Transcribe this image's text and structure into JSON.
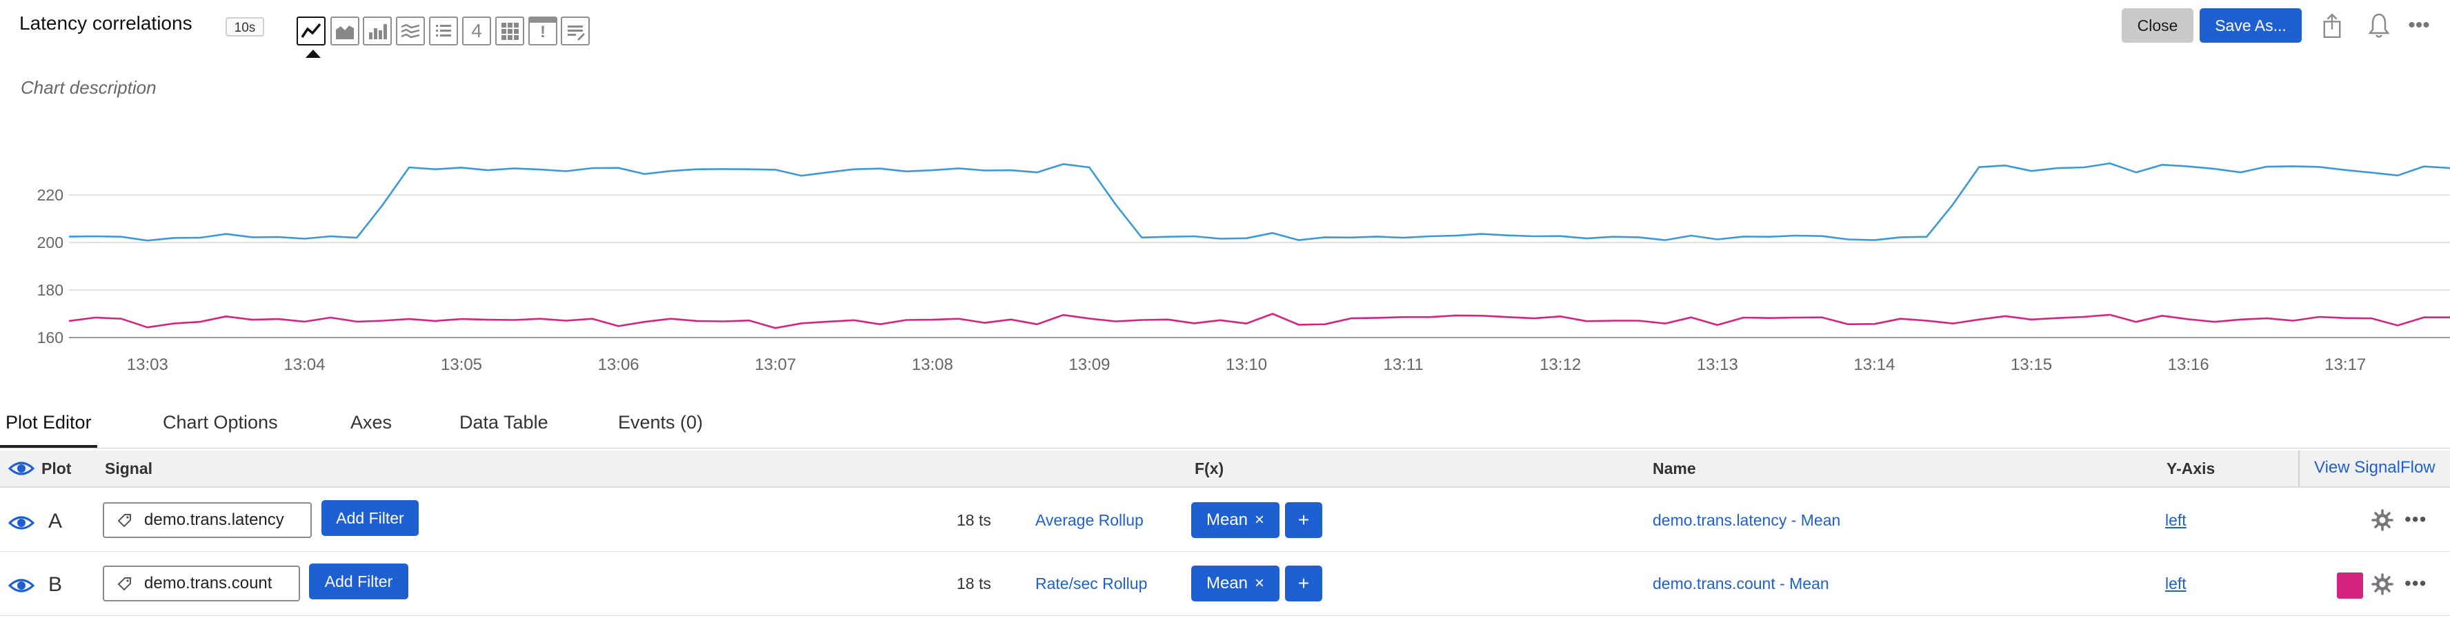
{
  "header": {
    "title": "Latency correlations",
    "resolution_badge": "10s",
    "chart_types": [
      {
        "name": "line-chart-icon",
        "active": true
      },
      {
        "name": "area-chart-icon",
        "active": false
      },
      {
        "name": "column-chart-icon",
        "active": false
      },
      {
        "name": "histogram-chart-icon",
        "active": false
      },
      {
        "name": "list-chart-icon",
        "active": false
      },
      {
        "name": "single-value-icon",
        "label": "4",
        "active": false
      },
      {
        "name": "heatmap-icon",
        "active": false
      },
      {
        "name": "event-feed-icon",
        "label": "!",
        "active": false
      },
      {
        "name": "text-note-icon",
        "active": false
      }
    ],
    "close_label": "Close",
    "save_label": "Save As...",
    "icons": [
      "share-icon",
      "bell-icon",
      "more-icon"
    ]
  },
  "description_placeholder": "Chart description",
  "chart_data": {
    "type": "line",
    "title": "",
    "xlabel": "",
    "ylabel": "",
    "ylim": [
      160,
      230
    ],
    "y_ticks": [
      "160",
      "180",
      "200",
      "220"
    ],
    "x_ticks": [
      "13:03",
      "13:04",
      "13:05",
      "13:06",
      "13:07",
      "13:08",
      "13:09",
      "13:10",
      "13:11",
      "13:12",
      "13:13",
      "13:14",
      "13:15",
      "13:16",
      "13:17"
    ],
    "x_start": "13:02:30",
    "x_end": "13:17:40",
    "grid": true,
    "legend": "none",
    "series": [
      {
        "color": "#3a9ad9",
        "values": [
          202.5,
          202.6,
          202.4,
          200.8,
          201.9,
          202.0,
          203.6,
          202.2,
          202.3,
          201.6,
          202.6,
          202.0,
          216,
          231.6,
          230.8,
          231.5,
          230.4,
          231.2,
          230.7,
          230.0,
          231.3,
          231.4,
          228.8,
          230.1,
          230.8,
          230.9,
          230.8,
          230.6,
          228.1,
          229.5,
          230.8,
          231.1,
          229.9,
          230.4,
          231.2,
          230.3,
          230.4,
          229.5,
          233.0,
          231.6,
          216,
          202.1,
          202.4,
          202.6,
          201.6,
          201.8,
          204.0,
          201.0,
          202.2,
          202.1,
          202.5,
          202.0,
          202.6,
          202.9,
          203.6,
          203.0,
          202.6,
          202.7,
          201.7,
          202.4,
          202.2,
          201.0,
          202.9,
          201.3,
          202.5,
          202.4,
          202.9,
          202.7,
          201.3,
          201.0,
          202.2,
          202.4,
          216,
          231.7,
          232.4,
          230.1,
          231.3,
          231.6,
          233.3,
          229.5,
          232.7,
          232.0,
          231.0,
          229.5,
          231.9,
          232.1,
          231.8,
          230.5,
          229.4,
          228.2,
          232.0,
          231.3
        ]
      },
      {
        "color": "#d6237f",
        "values": [
          167.0,
          168.4,
          167.9,
          164.3,
          165.9,
          166.6,
          168.9,
          167.5,
          167.8,
          166.7,
          168.4,
          166.7,
          167.1,
          167.8,
          167.0,
          167.8,
          167.5,
          167.4,
          167.9,
          167.1,
          167.9,
          164.8,
          166.6,
          167.9,
          167.0,
          166.8,
          167.2,
          164.0,
          166.0,
          166.7,
          167.3,
          165.6,
          167.4,
          167.5,
          167.9,
          166.2,
          167.6,
          165.6,
          169.5,
          168.0,
          166.8,
          167.4,
          167.6,
          166.0,
          167.3,
          165.9,
          170.0,
          165.4,
          165.6,
          168.1,
          168.3,
          168.6,
          168.6,
          169.3,
          169.2,
          168.6,
          168.1,
          168.9,
          166.9,
          167.1,
          167.1,
          165.9,
          168.5,
          165.3,
          168.4,
          168.2,
          168.4,
          168.5,
          165.6,
          165.7,
          167.9,
          167.1,
          165.9,
          167.6,
          169.0,
          167.6,
          168.2,
          168.7,
          169.6,
          166.6,
          169.2,
          167.7,
          166.6,
          167.6,
          168.1,
          167.1,
          168.7,
          168.2,
          168.1,
          165.1,
          168.5,
          168.5
        ]
      }
    ]
  },
  "tabs": {
    "plot_editor": "Plot Editor",
    "chart_options": "Chart Options",
    "axes": "Axes",
    "data_table": "Data Table",
    "events": "Events (0)"
  },
  "grid": {
    "headers": {
      "plot": "Plot",
      "signal": "Signal",
      "fx": "F(x)",
      "name": "Name",
      "yaxis": "Y-Axis",
      "view_signalflow": "View SignalFlow"
    },
    "rows": [
      {
        "letter": "A",
        "signal": "demo.trans.latency",
        "add_filter": "Add Filter",
        "ts": "18 ts",
        "rollup": "Average Rollup",
        "fx": "Mean",
        "fx_remove": "×",
        "add_fx": "+",
        "name": "demo.trans.latency - Mean",
        "yaxis": "left"
      },
      {
        "letter": "B",
        "signal": "demo.trans.count",
        "add_filter": "Add Filter",
        "ts": "18 ts",
        "rollup": "Rate/sec Rollup",
        "fx": "Mean",
        "fx_remove": "×",
        "add_fx": "+",
        "name": "demo.trans.count - Mean",
        "yaxis": "left",
        "color": "#d6237f"
      }
    ]
  }
}
